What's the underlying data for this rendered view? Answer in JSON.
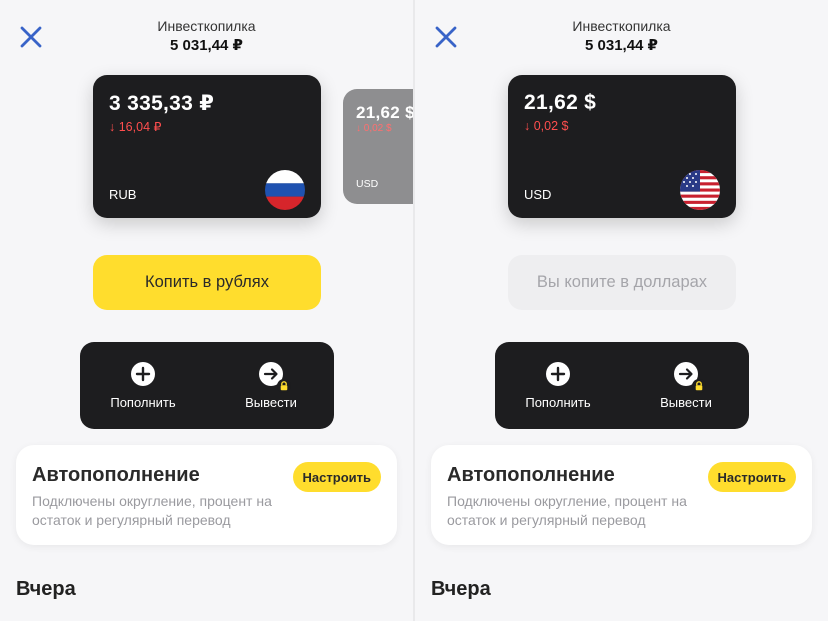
{
  "colors": {
    "accent_yellow": "#ffdd2d",
    "card_dark": "#1d1d1f",
    "card_gray": "#8e8e90",
    "negative_red": "#ff4e4e",
    "close_blue": "#3863c8"
  },
  "left": {
    "header": {
      "title": "Инвесткопилка",
      "amount": "5 031,44 ₽"
    },
    "main_card": {
      "amount": "3 335,33 ₽",
      "change": "16,04 ₽",
      "code": "RUB",
      "flag_icon": "russia-flag-icon"
    },
    "peek_card": {
      "amount": "21,62 $",
      "change": "0,02 $",
      "code": "USD",
      "flag_icon": "russia-flag-icon"
    },
    "save_button": "Копить в рублях",
    "actions": {
      "topup": "Пополнить",
      "withdraw": "Вывести"
    },
    "auto": {
      "title": "Автопополнение",
      "desc": "Подключены округление, процент на остаток и регулярный перевод",
      "button": "Настроить"
    },
    "section": "Вчера"
  },
  "right": {
    "header": {
      "title": "Инвесткопилка",
      "amount": "5 031,44 ₽"
    },
    "main_card": {
      "amount": "21,62 $",
      "change": "0,02 $",
      "code": "USD",
      "flag_icon": "usa-flag-icon"
    },
    "save_button": "Вы копите в долларах",
    "actions": {
      "topup": "Пополнить",
      "withdraw": "Вывести"
    },
    "auto": {
      "title": "Автопополнение",
      "desc": "Подключены округление, процент на остаток и регулярный перевод",
      "button": "Настроить"
    },
    "section": "Вчера"
  }
}
